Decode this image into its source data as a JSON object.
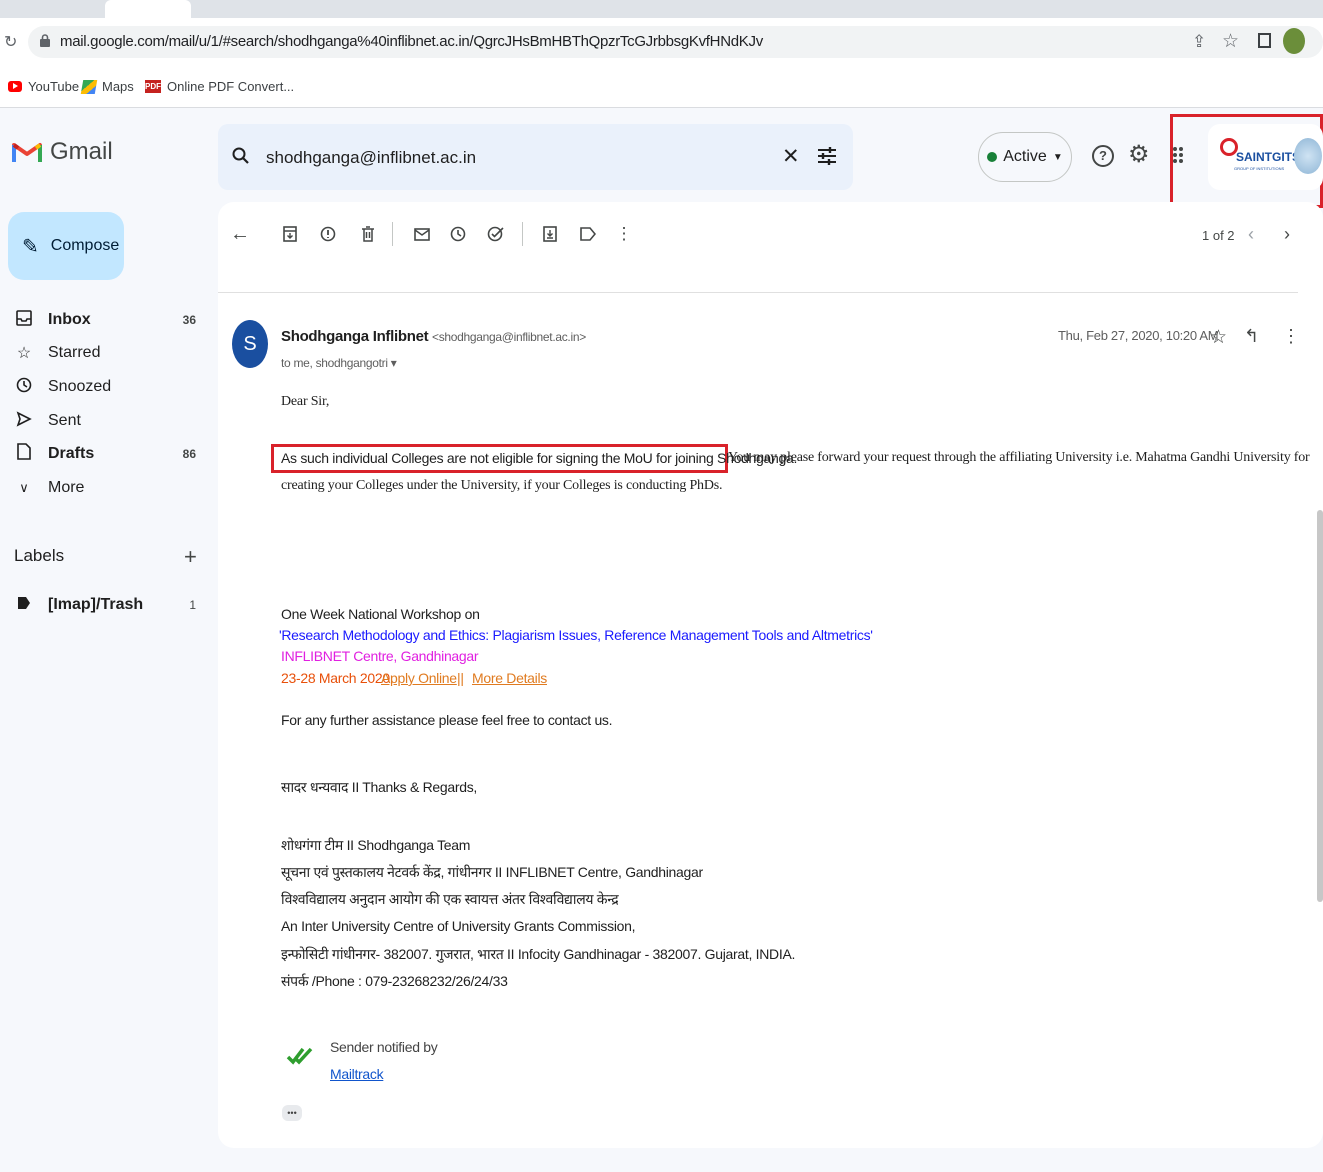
{
  "browser": {
    "url": "mail.google.com/mail/u/1/#search/shodhganga%40inflibnet.ac.in/QgrcJHsBmHBThQpzrTcGJrbbsgKvfHNdKJv",
    "bookmarks": [
      {
        "label": "YouTube"
      },
      {
        "label": "Maps"
      },
      {
        "label": "Online PDF Convert..."
      }
    ]
  },
  "app": {
    "name": "Gmail",
    "search_query": "shodhganga@inflibnet.ac.in",
    "status": "Active",
    "account_org": "SAINTGITS",
    "account_org_sub": "GROUP OF INSTITUTIONS"
  },
  "sidebar": {
    "compose": "Compose",
    "items": [
      {
        "label": "Inbox",
        "count": "36",
        "icon": "inbox-icon"
      },
      {
        "label": "Starred",
        "count": "",
        "icon": "star-icon"
      },
      {
        "label": "Snoozed",
        "count": "",
        "icon": "clock-icon"
      },
      {
        "label": "Sent",
        "count": "",
        "icon": "send-icon"
      },
      {
        "label": "Drafts",
        "count": "86",
        "icon": "draft-icon"
      },
      {
        "label": "More",
        "count": "",
        "icon": "chevron-down-icon"
      }
    ],
    "labels_heading": "Labels",
    "labels": [
      {
        "label": "[Imap]/Trash",
        "count": "1"
      }
    ]
  },
  "toolbar": {
    "pagination": "1 of 2"
  },
  "email": {
    "avatar_letter": "S",
    "sender_name": "Shodhganga Inflibnet",
    "sender_email": "<shodhganga@inflibnet.ac.in>",
    "recipients": "to me, shodhgangotri",
    "date": "Thu, Feb 27, 2020, 10:20 AM",
    "greeting": "Dear Sir,",
    "para1_highlighted": "As such individual Colleges are not eligible for signing the MoU for joining Shodhganga.",
    "para1_rest": "You may please forward your request through the affiliating University i.e. Mahatma Gandhi University for",
    "para1_line2": "creating your Colleges under the University, if your Colleges is conducting PhDs.",
    "workshop_line1": "One Week National Workshop on",
    "workshop_title": "'Research Methodology and Ethics: Plagiarism Issues, Reference Management Tools and Altmetrics'",
    "workshop_venue": "INFLIBNET Centre, Gandhinagar",
    "workshop_dates": "23-28 March 2020.",
    "apply_online": "Apply Online",
    "separator": "||",
    "more_details": "More Details",
    "assistance": "For any further assistance please feel free to contact us.",
    "regards": "सादर धन्यवाद II Thanks & Regards,",
    "sig1": "शोधगंगा टीम II Shodhganga Team",
    "sig2": "सूचना एवं पुस्तकालय नेटवर्क केंद्र, गांधीनगर II INFLIBNET Centre, Gandhinagar",
    "sig3": "विश्वविद्यालय अनुदान आयोग की एक स्वायत्त अंतर विश्वविद्यालय केन्द्र",
    "sig4": "An Inter University Centre of University Grants Commission,",
    "sig5": "इन्फोसिटी गांधीनगर- 382007. गुजरात, भारत  II Infocity Gandhinagar - 382007. Gujarat, INDIA.",
    "sig6": "संपर्क /Phone : 079-23268232/26/24/33",
    "notified_by": "Sender notified by",
    "mailtrack": "Mailtrack",
    "ellipsis": "•••"
  },
  "colors": {
    "highlight_box": "#d9222a",
    "workshop_title": "#1a1aff",
    "workshop_venue": "#e020e0",
    "workshop_dates": "#e8500a",
    "link_orange": "#e07b20"
  }
}
